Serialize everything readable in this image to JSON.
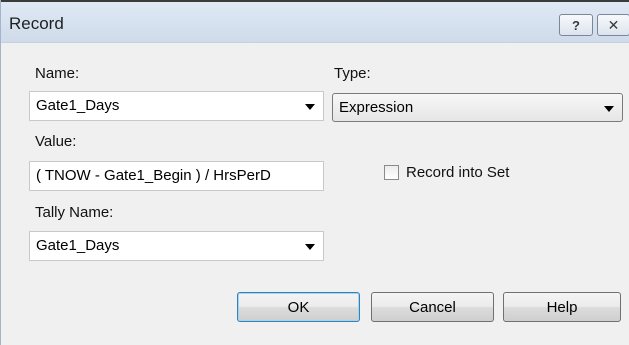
{
  "dialog": {
    "title": "Record",
    "help_glyph": "?",
    "close_glyph": "✕"
  },
  "form": {
    "name_label": "Name:",
    "name_value": "Gate1_Days",
    "type_label": "Type:",
    "type_value": "Expression",
    "value_label": "Value:",
    "value_value": "( TNOW - Gate1_Begin )  / HrsPerD",
    "record_into_set_label": "Record into Set",
    "record_into_set_checked": false,
    "tally_name_label": "Tally Name:",
    "tally_name_value": "Gate1_Days"
  },
  "buttons": {
    "ok": "OK",
    "cancel": "Cancel",
    "help": "Help"
  }
}
